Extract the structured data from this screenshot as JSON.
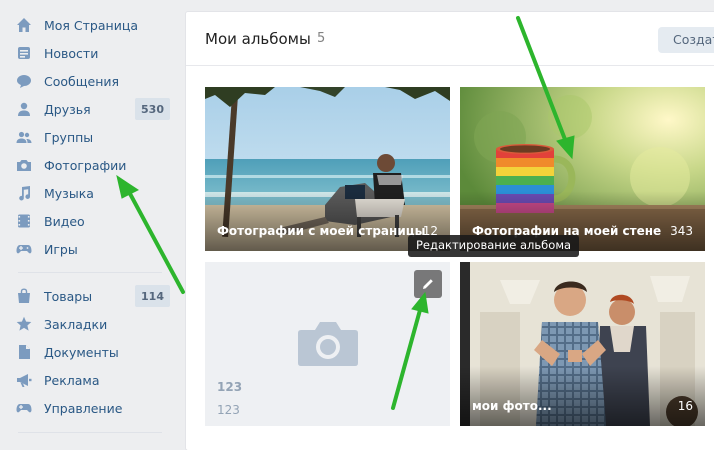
{
  "sidebar": {
    "items": [
      {
        "label": "Моя Страница",
        "icon": "home-icon"
      },
      {
        "label": "Новости",
        "icon": "news-icon"
      },
      {
        "label": "Сообщения",
        "icon": "messages-icon"
      },
      {
        "label": "Друзья",
        "icon": "friends-icon",
        "badge": "530"
      },
      {
        "label": "Группы",
        "icon": "groups-icon"
      },
      {
        "label": "Фотографии",
        "icon": "camera-icon"
      },
      {
        "label": "Музыка",
        "icon": "music-icon"
      },
      {
        "label": "Видео",
        "icon": "video-icon"
      },
      {
        "label": "Игры",
        "icon": "games-icon"
      },
      {
        "label": "Товары",
        "icon": "market-icon",
        "badge": "114"
      },
      {
        "label": "Закладки",
        "icon": "star-icon"
      },
      {
        "label": "Документы",
        "icon": "documents-icon"
      },
      {
        "label": "Реклама",
        "icon": "ads-icon"
      },
      {
        "label": "Управление",
        "icon": "gamepad-icon"
      }
    ]
  },
  "main": {
    "title": "Мои альбомы",
    "count": "5",
    "create_label": "Создать альбом",
    "albums": [
      {
        "title": "Фотографии с моей страницы",
        "count": "12"
      },
      {
        "title": "Фотографии на моей стене",
        "count": "343"
      },
      {
        "title": "123",
        "subtitle": "123"
      },
      {
        "title": "мои фото...",
        "count": "16"
      }
    ],
    "tooltip": "Редактирование альбома"
  },
  "colors": {
    "link": "#2a5885",
    "icon": "#7c9bbf",
    "badge_bg": "#dae2ea",
    "arrow": "#2db52d"
  }
}
